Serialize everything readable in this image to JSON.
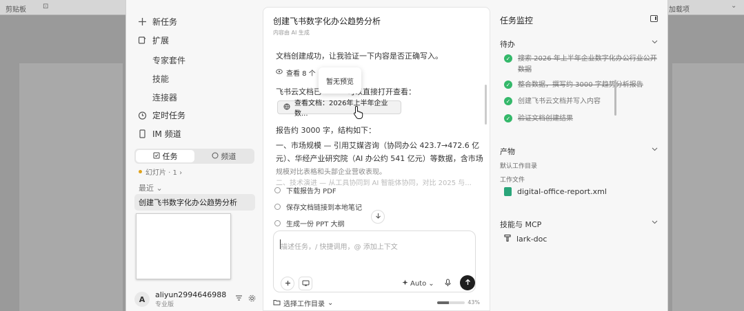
{
  "background": {
    "ribbon_left": "剪贴板",
    "ribbon_left_icon": "⊡",
    "ribbon_right": "加载项",
    "ribbon_right_icon": "⌄"
  },
  "sidebar": {
    "nav": [
      {
        "label": "新任务",
        "icon": "plus-icon"
      },
      {
        "label": "扩展",
        "icon": "extension-icon"
      }
    ],
    "sub_items": [
      "专家套件",
      "技能",
      "连接器"
    ],
    "nav2": [
      {
        "label": "定时任务",
        "icon": "timer-icon"
      },
      {
        "label": "IM 频道",
        "icon": "phone-icon"
      }
    ],
    "segment": [
      {
        "label": "任务",
        "icon": "task-icon"
      },
      {
        "label": "频道",
        "icon": "chat-icon"
      }
    ],
    "slide_tag": "幻灯片 · 1 ›",
    "recent_label": "最近 ⌄",
    "recent_item": "创建飞书数字化办公趋势分析",
    "user": {
      "avatar": "A",
      "name": "aliyun2994646988",
      "plan": "专业版"
    }
  },
  "main": {
    "title": "创建飞书数字化办公趋势分析",
    "subtitle": "内容由 AI 生成",
    "message1": "文档创建成功，让我验证一下内容是否正确写入。",
    "view_label": "查看 8 个",
    "tooltip": "暂无预览",
    "message2": "飞书云文档已",
    "message2_tail": "可以直接打开查看：",
    "doc_chip": "查看文档：2026年上半年企业数...",
    "report_line": "报告约 3000 字，结构如下：",
    "report_body_1": "一、市场规模 — 引用艾媒咨询（协同办公 423.7→472.6 亿",
    "report_body_2": "元）、华经产业研究院（AI 办公约 541 亿元）等数据，含市场",
    "report_body_3": "规模对比表格和头部企业营收表现。",
    "faded_line": "二、技术演进 — 从工具协同到 AI 智能体协同，对比 2025 与...",
    "actions": [
      "下载报告为 PDF",
      "保存文档链接到本地笔记",
      "生成一份 PPT 大纲"
    ],
    "composer": {
      "placeholder": "描述任务，/ 快捷调用，@ 添加上下文",
      "mode": "Auto",
      "mode_chevron": "⌄"
    },
    "bottom": {
      "dir_label": "选择工作目录",
      "dir_chevron": "⌄",
      "context_label": "43%",
      "context_progress": 0.43
    }
  },
  "right": {
    "title": "任务监控",
    "todo_head": "待办",
    "todos": [
      {
        "text": "搜索 2026 年上半年企业数字化办公行业公开数据",
        "done": true,
        "struck": true
      },
      {
        "text": "整合数据，撰写约 3000 字趋势分析报告",
        "done": true,
        "struck": true
      },
      {
        "text": "创建飞书云文档并写入内容",
        "done": true,
        "struck": false
      },
      {
        "text": "验证文档创建结果",
        "done": true,
        "struck": true
      }
    ],
    "artifacts_head": "产物",
    "default_dir": "默认工作目录",
    "work_files": "工作文件",
    "file_name": "digital-office-report.xml",
    "skills_head": "技能与 MCP",
    "skill_name": "lark-doc"
  },
  "colors": {
    "check": "#34b86a",
    "file_icon": "#2aa57a",
    "slide_dot": "#e0a21a"
  }
}
